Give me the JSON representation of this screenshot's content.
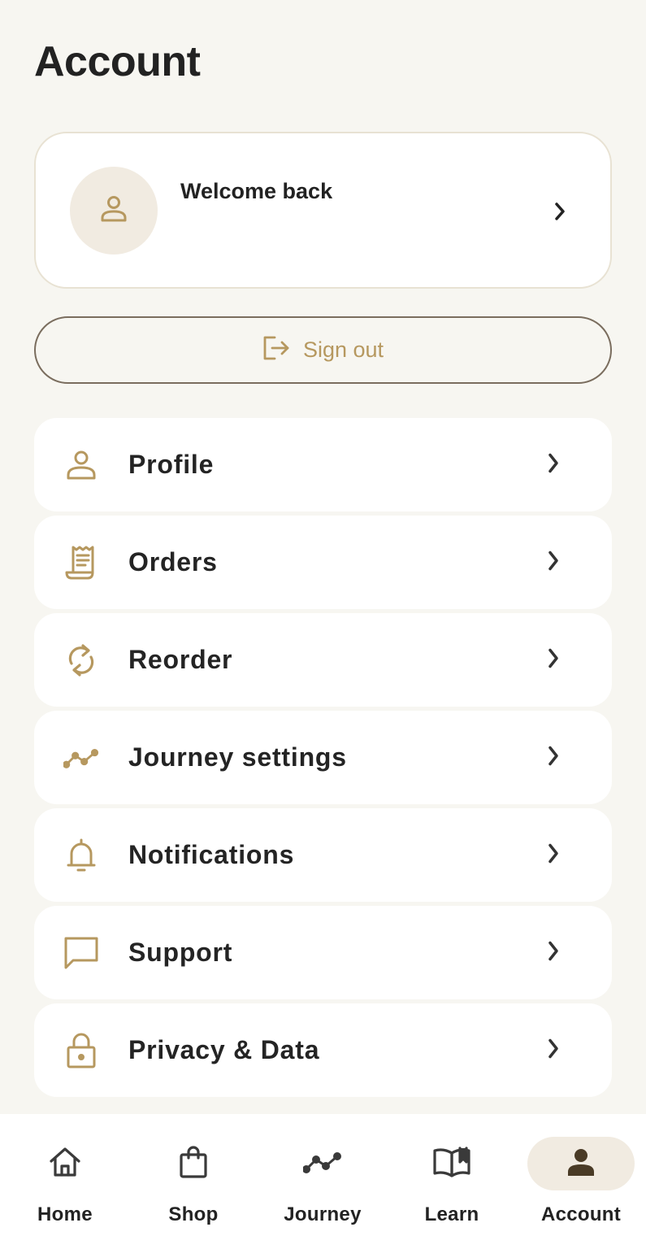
{
  "header": {
    "title": "Account"
  },
  "welcome_card": {
    "text": "Welcome back",
    "avatar_icon": "person-icon",
    "chevron_icon": "chevron-right-icon"
  },
  "sign_out": {
    "label": "Sign out",
    "icon": "logout-icon"
  },
  "menu": {
    "items": [
      {
        "label": "Profile",
        "icon": "person-icon"
      },
      {
        "label": "Orders",
        "icon": "receipt-icon"
      },
      {
        "label": "Reorder",
        "icon": "refresh-icon"
      },
      {
        "label": "Journey settings",
        "icon": "trend-line-icon"
      },
      {
        "label": "Notifications",
        "icon": "bell-icon"
      },
      {
        "label": "Support",
        "icon": "chat-bubble-icon"
      },
      {
        "label": "Privacy & Data",
        "icon": "lock-icon"
      }
    ]
  },
  "bottom_nav": {
    "items": [
      {
        "label": "Home",
        "icon": "home-icon",
        "active": false
      },
      {
        "label": "Shop",
        "icon": "shopping-bag-icon",
        "active": false
      },
      {
        "label": "Journey",
        "icon": "trend-line-icon",
        "active": false
      },
      {
        "label": "Learn",
        "icon": "book-icon",
        "active": false
      },
      {
        "label": "Account",
        "icon": "person-filled-icon",
        "active": true
      }
    ]
  },
  "colors": {
    "background": "#f7f6f1",
    "card": "#ffffff",
    "accent_gold": "#b6985f",
    "text_dark": "#242424",
    "active_pill": "#f1ebe1",
    "active_icon": "#4a3b26"
  }
}
